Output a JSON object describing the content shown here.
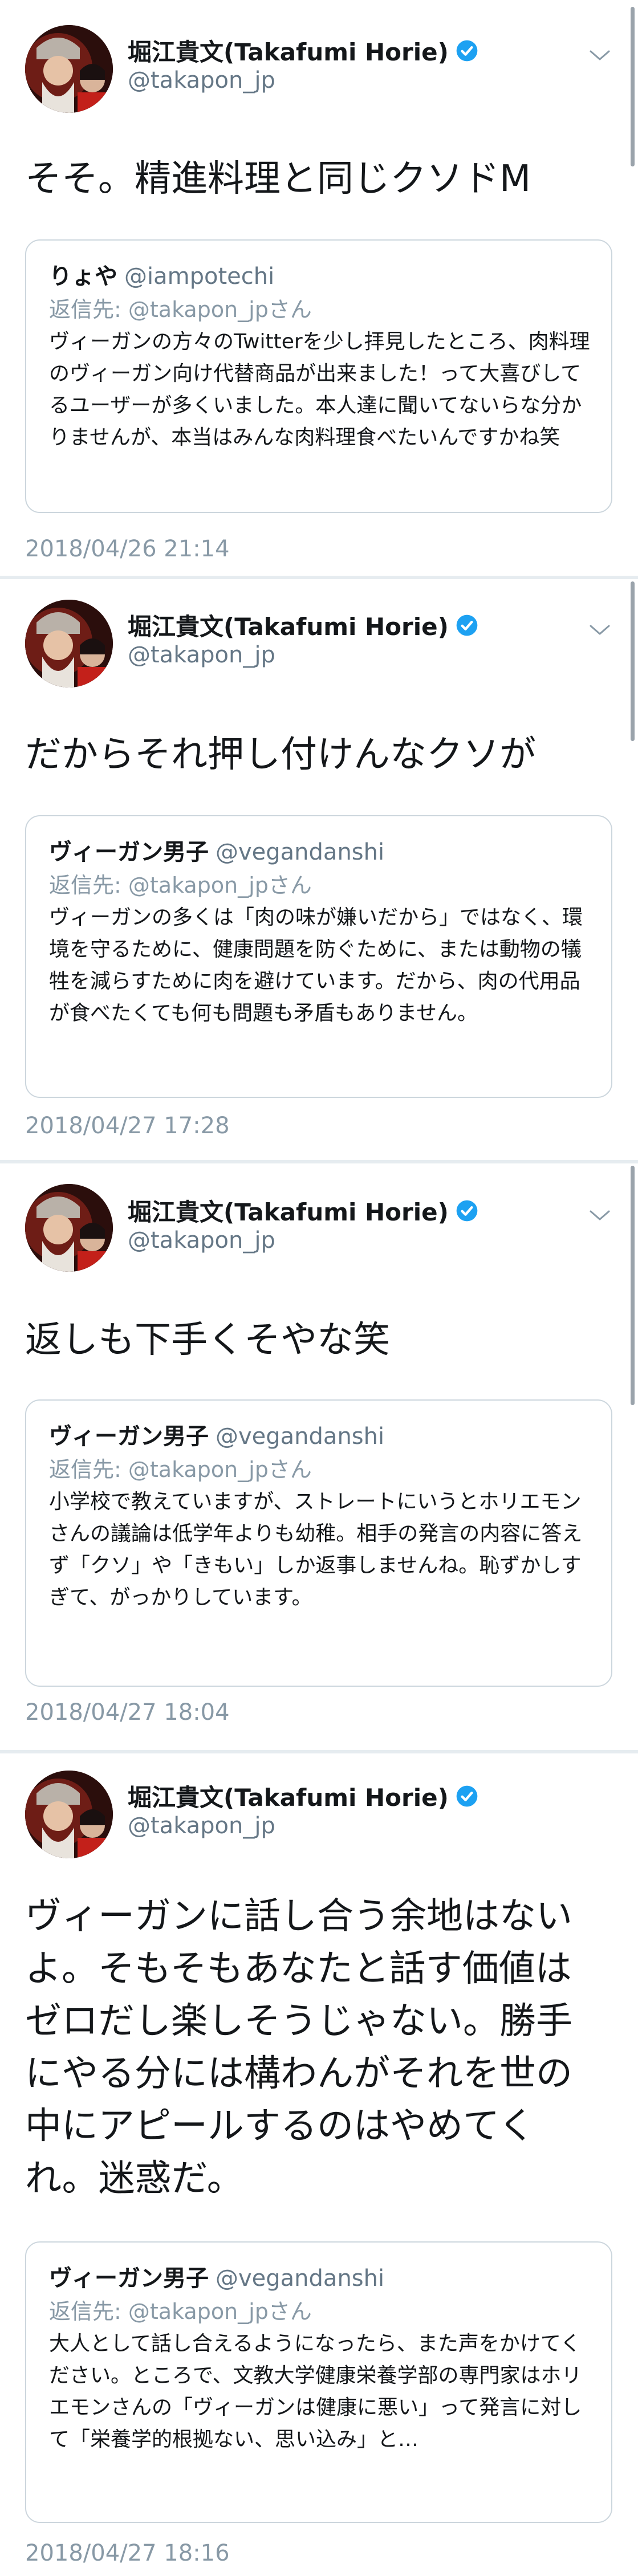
{
  "colors": {
    "verified_blue": "#1da1f2",
    "secondary_text": "#657786",
    "timestamp_text": "#8899a6",
    "border": "#ccd6dd"
  },
  "tweets": [
    {
      "author": {
        "name": "堀江貴文(Takafumi Horie)",
        "handle": "@takapon_jp",
        "verified_icon": "verified-badge-icon",
        "avatar_icon": "avatar-photo"
      },
      "text": "そそ。精進料理と同じクソドM",
      "quote": {
        "name": "りょや",
        "handle": "@iampotechi",
        "reply_to": "返信先: @takapon_jpさん",
        "body": "ヴィーガンの方々のTwitterを少し拝見したところ、肉料理のヴィーガン向け代替商品が出来ました！って大喜びしてるユーザーが多くいました。本人達に聞いてないらな分かりませんが、本当はみんな肉料理食べたいんですかね笑"
      },
      "timestamp": "2018/04/26 21:14"
    },
    {
      "author": {
        "name": "堀江貴文(Takafumi Horie)",
        "handle": "@takapon_jp",
        "verified_icon": "verified-badge-icon",
        "avatar_icon": "avatar-photo"
      },
      "text": "だからそれ押し付けんなクソが",
      "quote": {
        "name": "ヴィーガン男子",
        "handle": "@vegandanshi",
        "reply_to": "返信先: @takapon_jpさん",
        "body": "ヴィーガンの多くは「肉の味が嫌いだから」ではなく、環境を守るために、健康問題を防ぐために、または動物の犠牲を減らすために肉を避けています。だから、肉の代用品が食べたくても何も問題も矛盾もありません。"
      },
      "timestamp": "2018/04/27 17:28"
    },
    {
      "author": {
        "name": "堀江貴文(Takafumi Horie)",
        "handle": "@takapon_jp",
        "verified_icon": "verified-badge-icon",
        "avatar_icon": "avatar-photo"
      },
      "text": "返しも下手くそやな笑",
      "quote": {
        "name": "ヴィーガン男子",
        "handle": "@vegandanshi",
        "reply_to": "返信先: @takapon_jpさん",
        "body": "小学校で教えていますが、ストレートにいうとホリエモンさんの議論は低学年よりも幼稚。相手の発言の内容に答えず「クソ」や「きもい」しか返事しませんね。恥ずかしすぎて、がっかりしています。"
      },
      "timestamp": "2018/04/27 18:04"
    },
    {
      "author": {
        "name": "堀江貴文(Takafumi Horie)",
        "handle": "@takapon_jp",
        "verified_icon": "verified-badge-icon",
        "avatar_icon": "avatar-photo"
      },
      "text": "ヴィーガンに話し合う余地はないよ。そもそもあなたと話す価値はゼロだし楽しそうじゃない。勝手にやる分には構わんがそれを世の中にアピールするのはやめてくれ。迷惑だ。",
      "quote": {
        "name": "ヴィーガン男子",
        "handle": "@vegandanshi",
        "reply_to": "返信先: @takapon_jpさん",
        "body": "大人として話し合えるようになったら、また声をかけてください。ところで、文教大学健康栄養学部の専門家はホリエモンさんの「ヴィーガンは健康に悪い」って発言に対して「栄養学的根拠ない、思い込み」と…"
      },
      "timestamp": "2018/04/27 18:16"
    }
  ]
}
